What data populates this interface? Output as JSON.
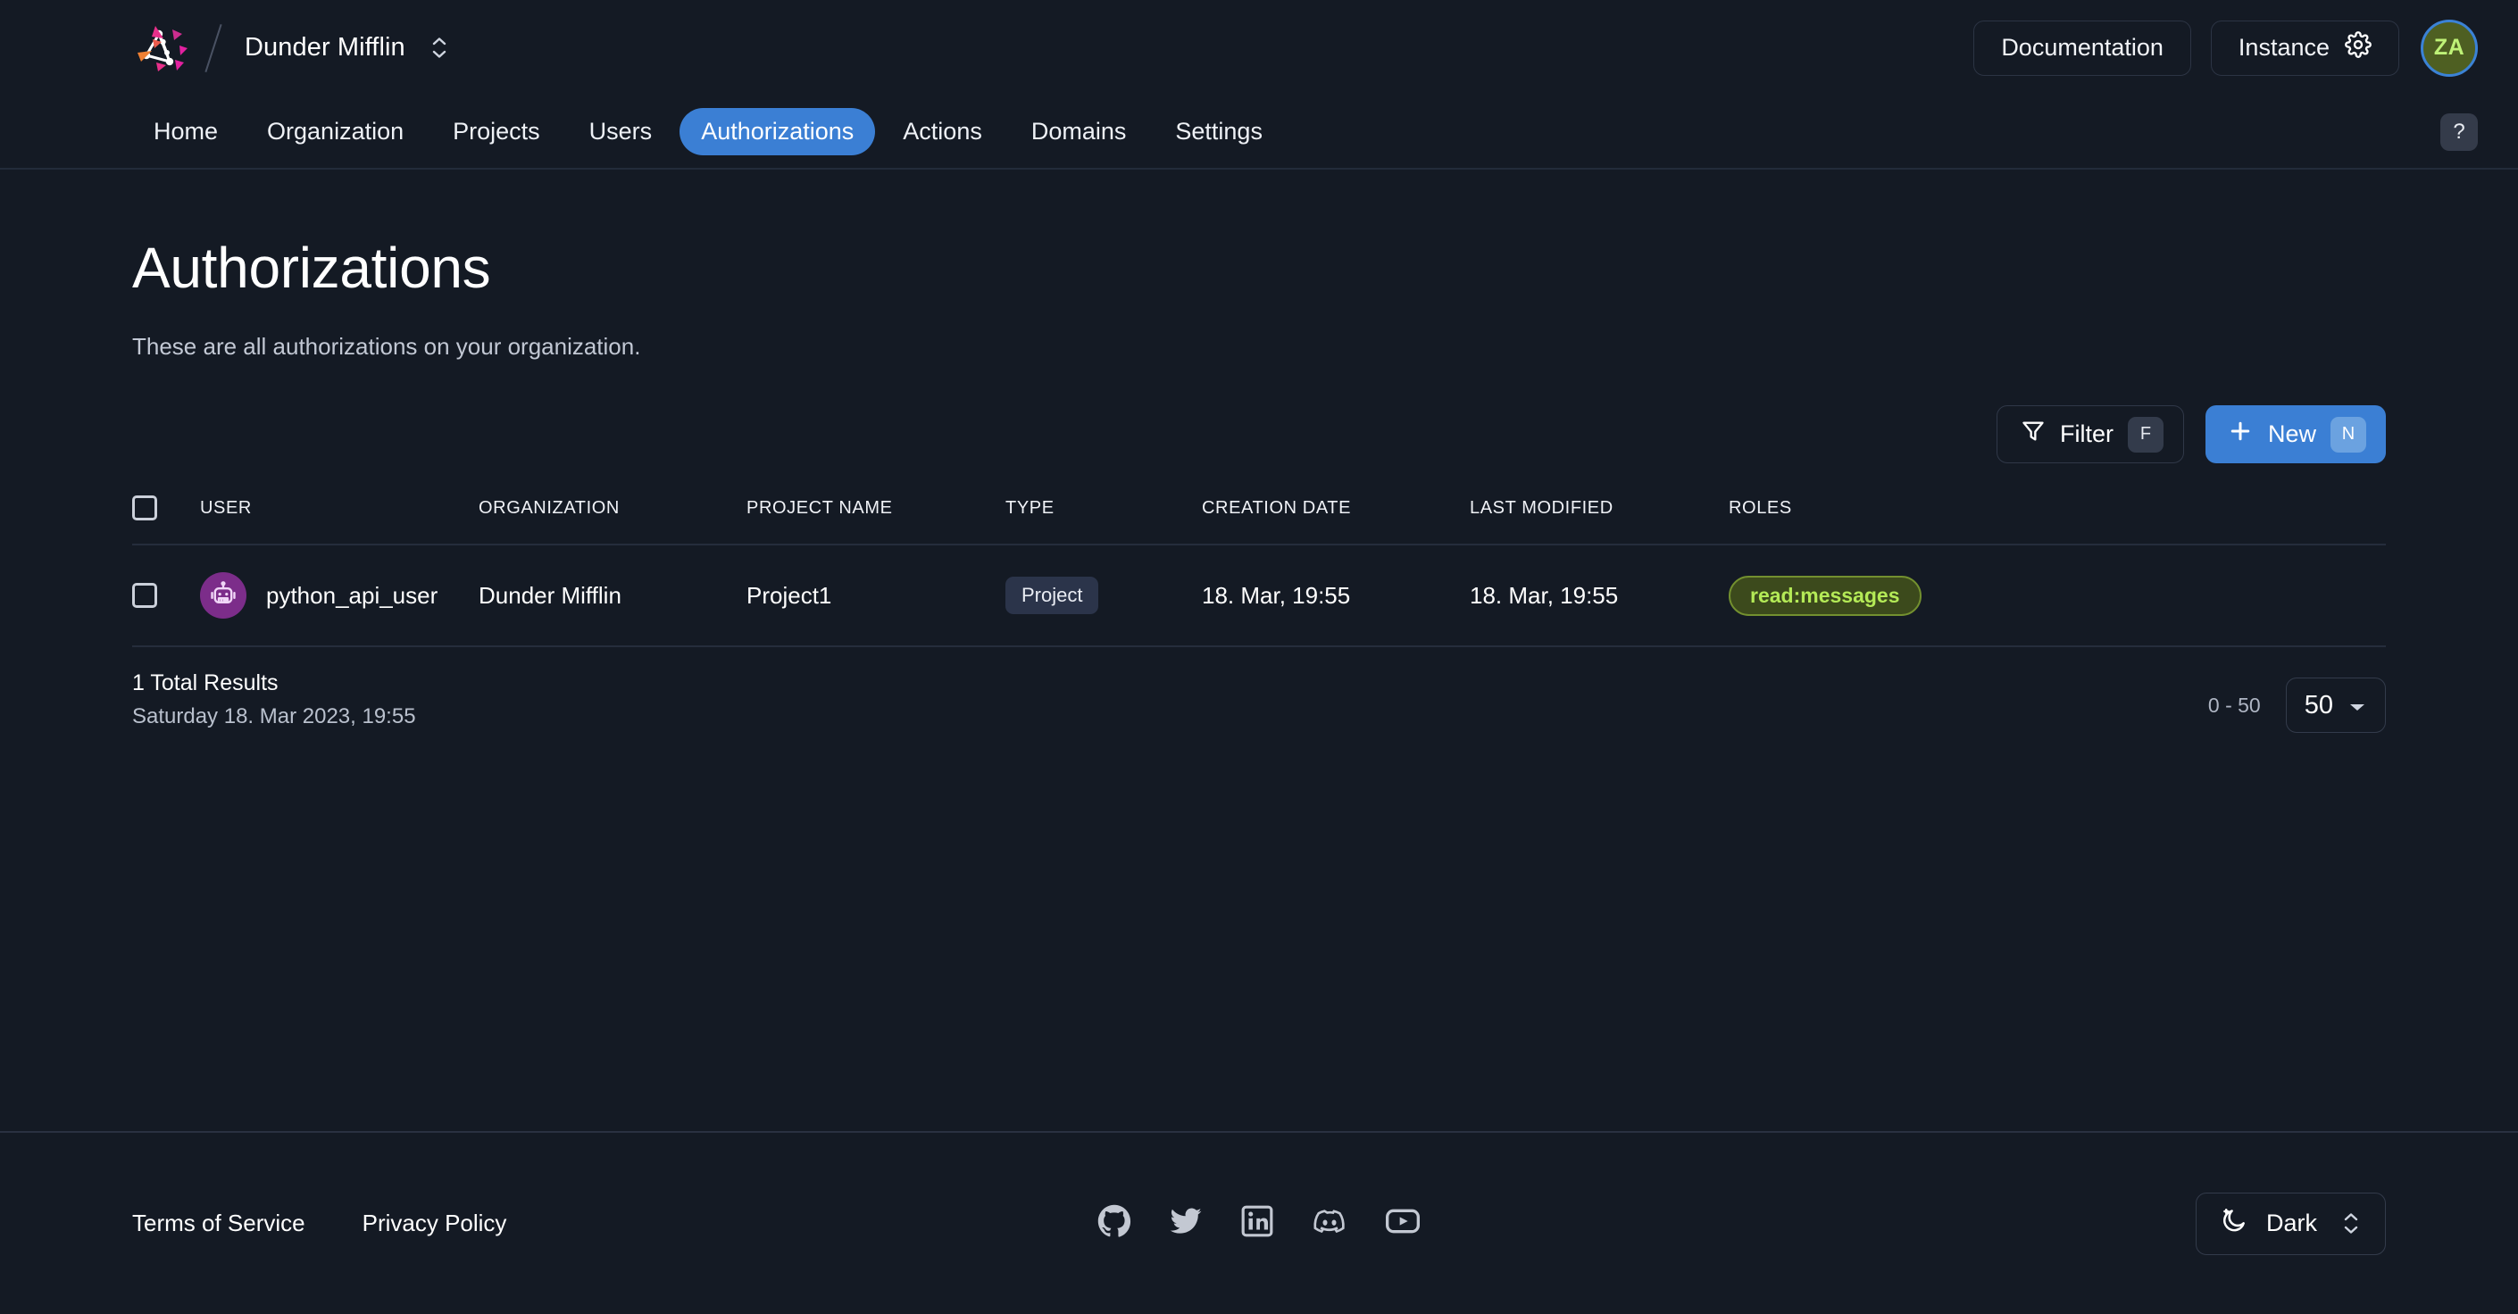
{
  "header": {
    "logo_icon": "triangle-network-logo",
    "organization_name": "Dunder Mifflin",
    "org_switch_icon": "chevron-up-down-icon",
    "documentation_label": "Documentation",
    "instance_label": "Instance",
    "instance_icon": "gear-icon",
    "avatar_initials": "ZA",
    "avatar_bg": "#4e5f22",
    "avatar_text_color": "#bff277",
    "avatar_ring_color": "#3b82d6"
  },
  "nav": {
    "items": [
      {
        "label": "Home",
        "active": false
      },
      {
        "label": "Organization",
        "active": false
      },
      {
        "label": "Projects",
        "active": false
      },
      {
        "label": "Users",
        "active": false
      },
      {
        "label": "Authorizations",
        "active": true
      },
      {
        "label": "Actions",
        "active": false
      },
      {
        "label": "Domains",
        "active": false
      },
      {
        "label": "Settings",
        "active": false
      }
    ],
    "help_label": "?",
    "active_color": "#3b7fd4"
  },
  "page": {
    "title": "Authorizations",
    "description": "These are all authorizations on your organization."
  },
  "toolbar": {
    "filter_label": "Filter",
    "filter_icon": "funnel-icon",
    "filter_shortcut": "F",
    "new_label": "New",
    "new_icon": "plus-icon",
    "new_shortcut": "N",
    "new_bg": "#3b7fd4"
  },
  "table": {
    "select_all_icon": "checkbox-unchecked",
    "columns": [
      "USER",
      "ORGANIZATION",
      "PROJECT NAME",
      "TYPE",
      "CREATION DATE",
      "LAST MODIFIED",
      "ROLES"
    ],
    "rows": [
      {
        "checkbox_icon": "checkbox-unchecked",
        "avatar_icon": "robot-icon",
        "avatar_bg": "#7c2d8a",
        "user": "python_api_user",
        "organization": "Dunder Mifflin",
        "project_name": "Project1",
        "type": "Project",
        "creation_date": "18. Mar, 19:55",
        "last_modified": "18. Mar, 19:55",
        "roles": "read:messages",
        "role_color": "#b4ea57"
      }
    ]
  },
  "table_footer": {
    "total_results": "1 Total Results",
    "timestamp": "Saturday 18. Mar 2023, 19:55",
    "page_range": "0 - 50",
    "page_size": "50",
    "page_size_icon": "chevron-down-icon"
  },
  "footer": {
    "terms_label": "Terms of Service",
    "privacy_label": "Privacy Policy",
    "socials": [
      {
        "name": "github-icon"
      },
      {
        "name": "twitter-icon"
      },
      {
        "name": "linkedin-icon"
      },
      {
        "name": "discord-icon"
      },
      {
        "name": "youtube-icon"
      }
    ],
    "theme_label": "Dark",
    "theme_icon": "moon-icon",
    "theme_switch_icon": "chevron-up-down-icon"
  }
}
